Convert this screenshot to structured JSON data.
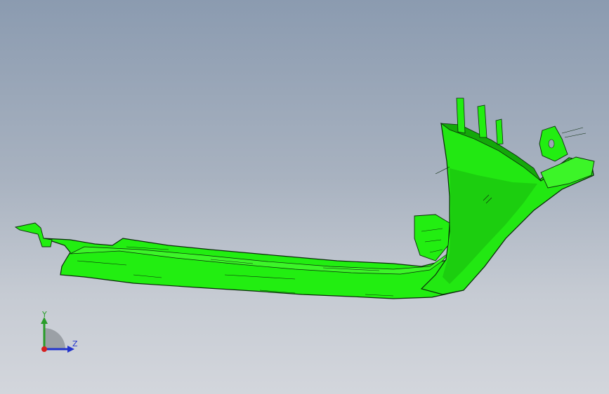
{
  "viewport": {
    "background_top": "#8b9bb0",
    "background_bottom": "#d3d6dc"
  },
  "model": {
    "color": "#22ee11",
    "edge_color": "#0a2a0a",
    "shade_color": "#18b80c"
  },
  "triad": {
    "y_label": "Y",
    "z_label": "Z",
    "y_color": "#2a9d2a",
    "z_color": "#2233cc",
    "x_color": "#d62020"
  }
}
